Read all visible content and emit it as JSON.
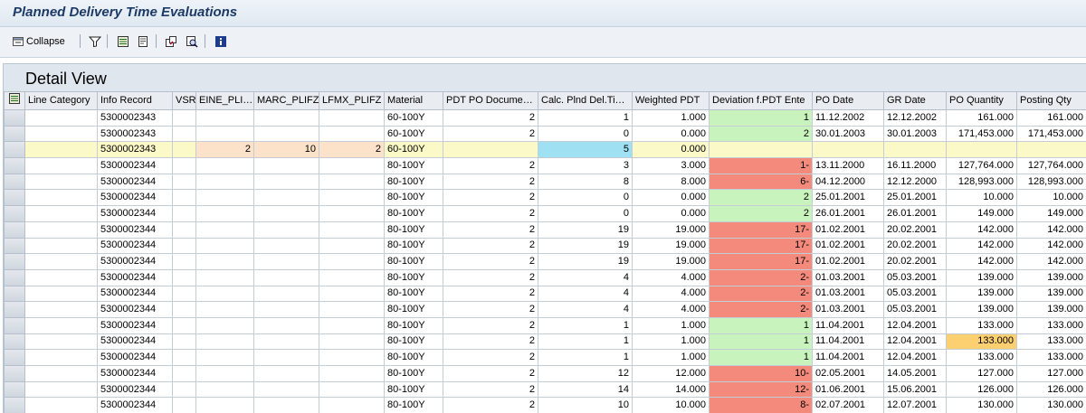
{
  "window": {
    "title": "Planned Delivery Time Evaluations"
  },
  "toolbar": {
    "collapse_label": "Collapse",
    "icons": [
      "collapse-icon",
      "filter-icon",
      "details-icon",
      "print-icon",
      "export-icon",
      "find-icon",
      "info-icon"
    ]
  },
  "panel": {
    "title": "Detail View"
  },
  "colors": {
    "highlight_row": "#fbf9c8",
    "orange_cell": "#fbe2c8",
    "blue_cell": "#9fe1f2",
    "green_cell": "#c9f3bd",
    "red_cell": "#f48a7b",
    "yellow_cell": "#fcd071"
  },
  "table": {
    "columns": [
      "Line Category",
      "Info Record",
      "VSR",
      "EINE_PLI…",
      "MARC_PLIFZ",
      "LFMX_PLIFZ",
      "Material",
      "PDT PO Docume…",
      "Calc. Plnd Del.Ti…",
      "Weighted PDT",
      "Deviation f.PDT Ente",
      "PO Date",
      "GR Date",
      "PO Quantity",
      "Posting Qty"
    ],
    "rows": [
      {
        "cells": [
          "",
          "5300002343",
          "",
          "",
          "",
          "",
          "60-100Y",
          "2",
          "1",
          "1.000",
          "1",
          "11.12.2002",
          "12.12.2002",
          "161.000",
          "161.000"
        ],
        "dev": "green"
      },
      {
        "cells": [
          "",
          "5300002343",
          "",
          "",
          "",
          "",
          "60-100Y",
          "2",
          "0",
          "0.000",
          "2",
          "30.01.2003",
          "30.01.2003",
          "171,453.000",
          "171,453.000"
        ],
        "dev": "green"
      },
      {
        "cells": [
          "",
          "5300002343",
          "",
          "2",
          "10",
          "2",
          "60-100Y",
          "",
          "5",
          "0.000",
          "",
          "",
          "",
          "",
          ""
        ],
        "dev": "",
        "highlight": true
      },
      {
        "cells": [
          "",
          "5300002344",
          "",
          "",
          "",
          "",
          "80-100Y",
          "2",
          "3",
          "3.000",
          "1-",
          "13.11.2000",
          "16.11.2000",
          "127,764.000",
          "127,764.000"
        ],
        "dev": "red"
      },
      {
        "cells": [
          "",
          "5300002344",
          "",
          "",
          "",
          "",
          "80-100Y",
          "2",
          "8",
          "8.000",
          "6-",
          "04.12.2000",
          "12.12.2000",
          "128,993.000",
          "128,993.000"
        ],
        "dev": "red"
      },
      {
        "cells": [
          "",
          "5300002344",
          "",
          "",
          "",
          "",
          "80-100Y",
          "2",
          "0",
          "0.000",
          "2",
          "25.01.2001",
          "25.01.2001",
          "10.000",
          "10.000"
        ],
        "dev": "green"
      },
      {
        "cells": [
          "",
          "5300002344",
          "",
          "",
          "",
          "",
          "80-100Y",
          "2",
          "0",
          "0.000",
          "2",
          "26.01.2001",
          "26.01.2001",
          "149.000",
          "149.000"
        ],
        "dev": "green"
      },
      {
        "cells": [
          "",
          "5300002344",
          "",
          "",
          "",
          "",
          "80-100Y",
          "2",
          "19",
          "19.000",
          "17-",
          "01.02.2001",
          "20.02.2001",
          "142.000",
          "142.000"
        ],
        "dev": "red"
      },
      {
        "cells": [
          "",
          "5300002344",
          "",
          "",
          "",
          "",
          "80-100Y",
          "2",
          "19",
          "19.000",
          "17-",
          "01.02.2001",
          "20.02.2001",
          "142.000",
          "142.000"
        ],
        "dev": "red"
      },
      {
        "cells": [
          "",
          "5300002344",
          "",
          "",
          "",
          "",
          "80-100Y",
          "2",
          "19",
          "19.000",
          "17-",
          "01.02.2001",
          "20.02.2001",
          "142.000",
          "142.000"
        ],
        "dev": "red"
      },
      {
        "cells": [
          "",
          "5300002344",
          "",
          "",
          "",
          "",
          "80-100Y",
          "2",
          "4",
          "4.000",
          "2-",
          "01.03.2001",
          "05.03.2001",
          "139.000",
          "139.000"
        ],
        "dev": "red"
      },
      {
        "cells": [
          "",
          "5300002344",
          "",
          "",
          "",
          "",
          "80-100Y",
          "2",
          "4",
          "4.000",
          "2-",
          "01.03.2001",
          "05.03.2001",
          "139.000",
          "139.000"
        ],
        "dev": "red"
      },
      {
        "cells": [
          "",
          "5300002344",
          "",
          "",
          "",
          "",
          "80-100Y",
          "2",
          "4",
          "4.000",
          "2-",
          "01.03.2001",
          "05.03.2001",
          "139.000",
          "139.000"
        ],
        "dev": "red"
      },
      {
        "cells": [
          "",
          "5300002344",
          "",
          "",
          "",
          "",
          "80-100Y",
          "2",
          "1",
          "1.000",
          "1",
          "11.04.2001",
          "12.04.2001",
          "133.000",
          "133.000"
        ],
        "dev": "green"
      },
      {
        "cells": [
          "",
          "5300002344",
          "",
          "",
          "",
          "",
          "80-100Y",
          "2",
          "1",
          "1.000",
          "1",
          "11.04.2001",
          "12.04.2001",
          "133.000",
          "133.000"
        ],
        "dev": "green",
        "qty_yellow": true
      },
      {
        "cells": [
          "",
          "5300002344",
          "",
          "",
          "",
          "",
          "80-100Y",
          "2",
          "1",
          "1.000",
          "1",
          "11.04.2001",
          "12.04.2001",
          "133.000",
          "133.000"
        ],
        "dev": "green"
      },
      {
        "cells": [
          "",
          "5300002344",
          "",
          "",
          "",
          "",
          "80-100Y",
          "2",
          "12",
          "12.000",
          "10-",
          "02.05.2001",
          "14.05.2001",
          "127.000",
          "127.000"
        ],
        "dev": "red"
      },
      {
        "cells": [
          "",
          "5300002344",
          "",
          "",
          "",
          "",
          "80-100Y",
          "2",
          "14",
          "14.000",
          "12-",
          "01.06.2001",
          "15.06.2001",
          "126.000",
          "126.000"
        ],
        "dev": "red"
      },
      {
        "cells": [
          "",
          "5300002344",
          "",
          "",
          "",
          "",
          "80-100Y",
          "2",
          "10",
          "10.000",
          "8-",
          "02.07.2001",
          "12.07.2001",
          "130.000",
          "130.000"
        ],
        "dev": "red"
      }
    ]
  }
}
